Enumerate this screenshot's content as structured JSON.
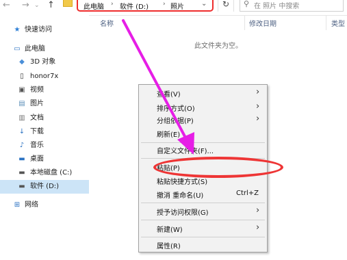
{
  "breadcrumb": {
    "c1": "此电脑",
    "c2": "软件 (D:)",
    "c3": "照片"
  },
  "search": {
    "placeholder": "在 照片 中搜索"
  },
  "nav": {
    "quick_access": "快速访问",
    "this_pc": "此电脑",
    "objects3d": "3D 对象",
    "phone": "honor7x",
    "videos": "视频",
    "pictures": "图片",
    "documents": "文档",
    "downloads": "下载",
    "music": "音乐",
    "desktop": "桌面",
    "drive_c": "本地磁盘 (C:)",
    "drive_d": "软件 (D:)",
    "network": "网络"
  },
  "columns": {
    "name": "名称",
    "modified": "修改日期",
    "type": "类型"
  },
  "empty_message": "此文件夹为空。",
  "menu": {
    "view": "查看(V)",
    "sort": "排序方式(O)",
    "group": "分组依据(P)",
    "refresh": "刷新(E)",
    "customize": "自定义文件夹(F)...",
    "paste": "粘贴(P)",
    "paste_shortcut": "粘贴快捷方式(S)",
    "undo": "撤消 重命名(U)",
    "undo_shortcut": "Ctrl+Z",
    "grant_access": "授予访问权限(G)",
    "new": "新建(W)",
    "properties": "属性(R)"
  },
  "colors": {
    "annotation_red": "#ee3535",
    "arrow_magenta": "#e61ee6",
    "selection": "#cce4f7"
  }
}
